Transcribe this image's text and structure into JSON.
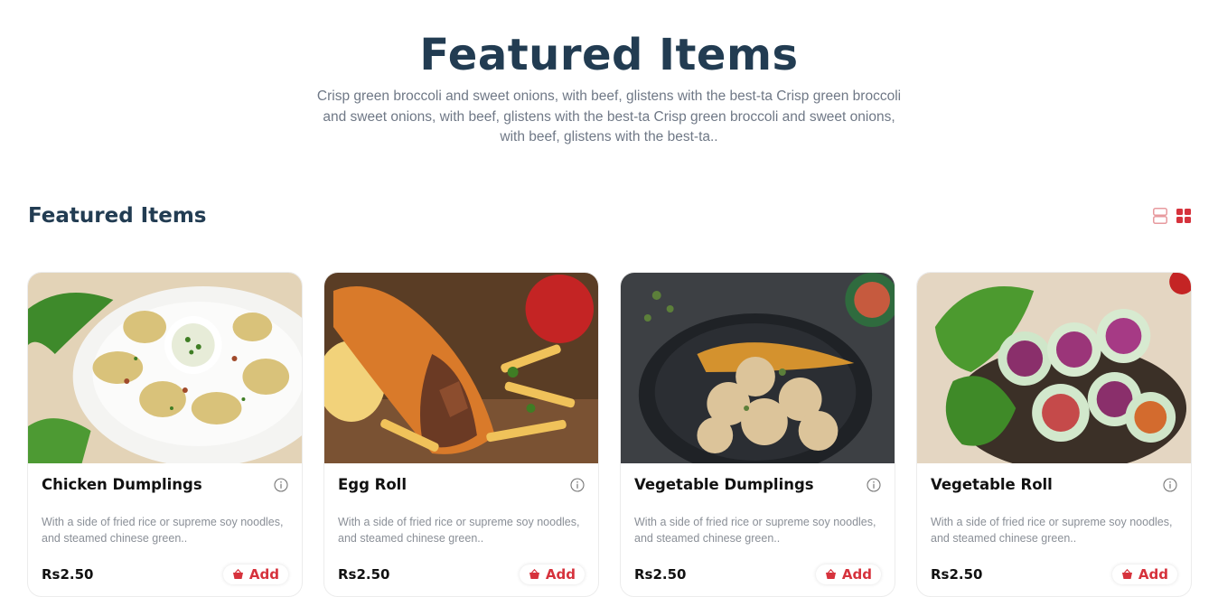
{
  "hero": {
    "title": "Featured Items",
    "description": "Crisp green broccoli and sweet onions, with beef, glistens with the best-ta Crisp green broccoli and sweet onions, with beef, glistens with the best-ta Crisp green broccoli and sweet onions, with beef, glistens with the best-ta.."
  },
  "section": {
    "title": "Featured Items",
    "view_modes": [
      "list-view-icon",
      "grid-view-icon"
    ],
    "active_view": "grid"
  },
  "colors": {
    "accent": "#d6323c",
    "heading": "#223c52",
    "muted": "#8a8f97"
  },
  "items": [
    {
      "name": "Chicken Dumplings",
      "description": "With a side of fried rice or supreme soy noodles, and steamed chinese green..",
      "price": "Rs2.50",
      "add_label": "Add"
    },
    {
      "name": "Egg Roll",
      "description": "With a side of fried rice or supreme soy noodles, and steamed chinese green..",
      "price": "Rs2.50",
      "add_label": "Add"
    },
    {
      "name": "Vegetable Dumplings",
      "description": "With a side of fried rice or supreme soy noodles, and steamed chinese green..",
      "price": "Rs2.50",
      "add_label": "Add"
    },
    {
      "name": "Vegetable Roll",
      "description": "With a side of fried rice or supreme soy noodles, and steamed chinese green..",
      "price": "Rs2.50",
      "add_label": "Add"
    }
  ]
}
